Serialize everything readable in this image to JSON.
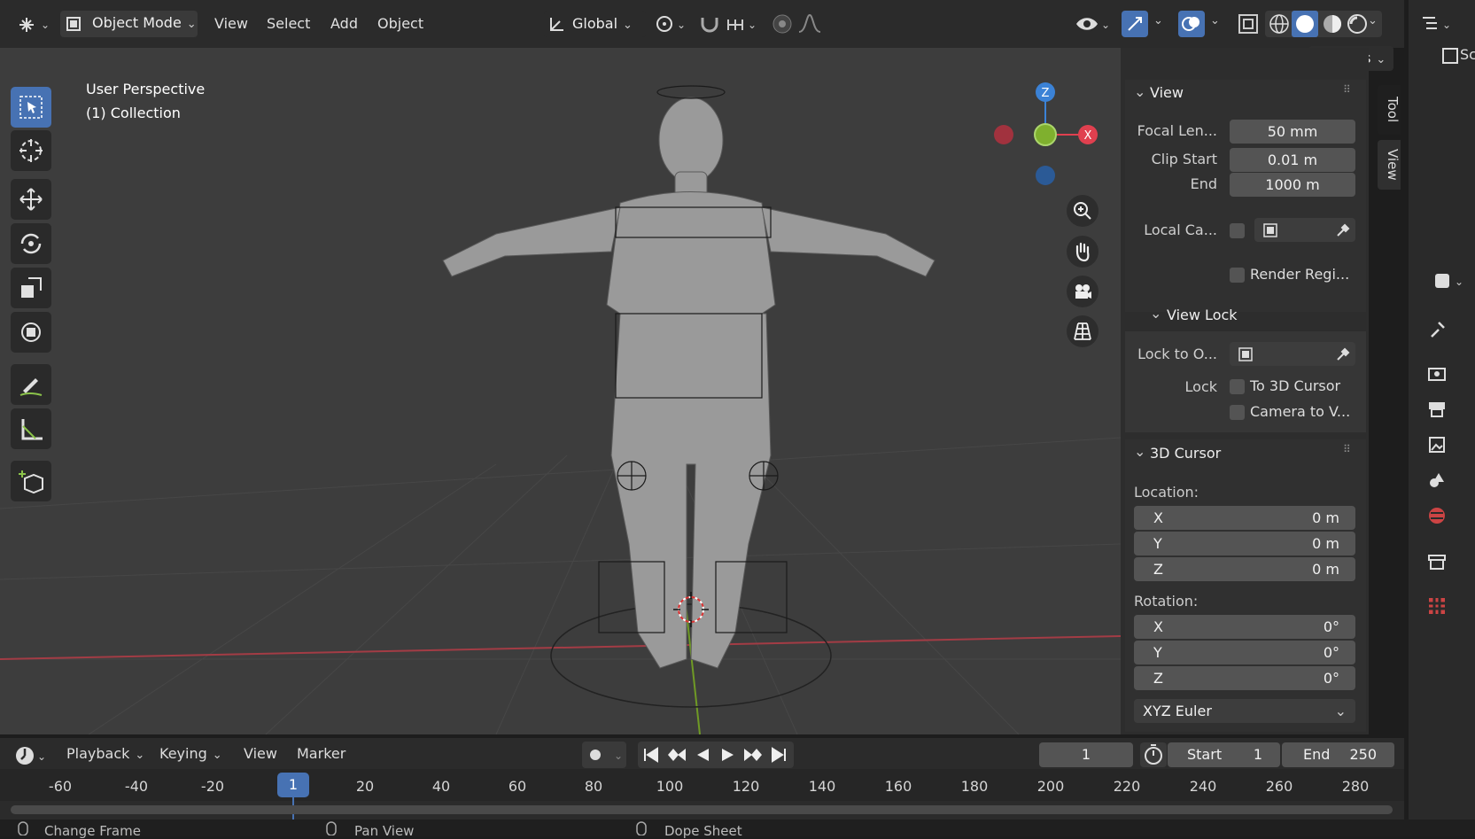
{
  "header": {
    "mode": "Object Mode",
    "menus": [
      "View",
      "Select",
      "Add",
      "Object"
    ],
    "orientation": "Global",
    "options": "Options"
  },
  "viewport": {
    "title": "User Perspective",
    "collection": "(1) Collection",
    "gizmo": {
      "z": "Z",
      "x": "X"
    }
  },
  "sidebar_tabs": {
    "tool": "Tool",
    "view": "View"
  },
  "view_panel": {
    "header": "View",
    "focal_label": "Focal Len...",
    "focal_value": "50 mm",
    "clip_start_label": "Clip Start",
    "clip_start_value": "0.01 m",
    "clip_end_label": "End",
    "clip_end_value": "1000 m",
    "local_cam_label": "Local Ca...",
    "render_region_label": "Render Regi..."
  },
  "view_lock": {
    "header": "View Lock",
    "lock_to_label": "Lock to O...",
    "lock_label": "Lock",
    "to_cursor_label": "To 3D Cursor",
    "camera_label": "Camera to V..."
  },
  "cursor_panel": {
    "header": "3D Cursor",
    "location_label": "Location:",
    "location": [
      {
        "axis": "X",
        "value": "0 m"
      },
      {
        "axis": "Y",
        "value": "0 m"
      },
      {
        "axis": "Z",
        "value": "0 m"
      }
    ],
    "rotation_label": "Rotation:",
    "rotation": [
      {
        "axis": "X",
        "value": "0°"
      },
      {
        "axis": "Y",
        "value": "0°"
      },
      {
        "axis": "Z",
        "value": "0°"
      }
    ],
    "rotation_mode": "XYZ Euler"
  },
  "timeline": {
    "menus": {
      "playback": "Playback",
      "keying": "Keying",
      "view": "View",
      "marker": "Marker"
    },
    "current_frame": "1",
    "start_label": "Start",
    "start_value": "1",
    "end_label": "End",
    "end_value": "250",
    "ticks": [
      "-60",
      "-40",
      "-20",
      "1",
      "20",
      "40",
      "60",
      "80",
      "100",
      "120",
      "140",
      "160",
      "180",
      "200",
      "220",
      "240",
      "260",
      "280"
    ]
  },
  "status_bar": {
    "item1": "Change Frame",
    "item2": "Pan View",
    "item3": "Dope Sheet"
  },
  "colors": {
    "accent": "#4772b3",
    "x_axis": "#e0404f",
    "y_axis": "#7fb02e",
    "z_axis": "#3b82d6"
  }
}
